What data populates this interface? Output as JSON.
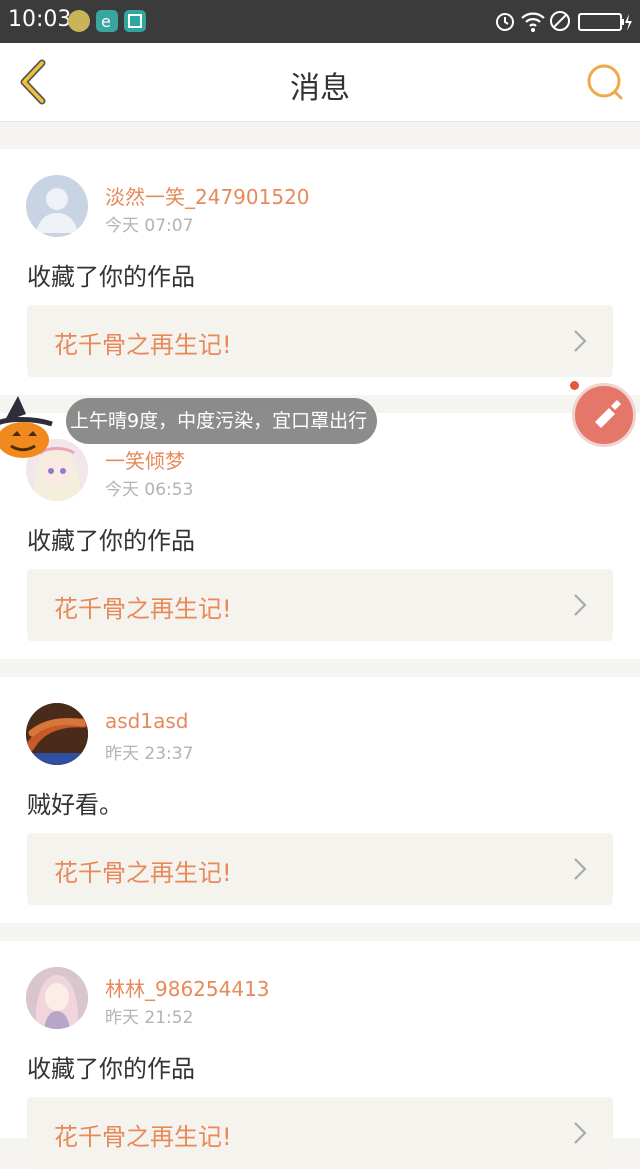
{
  "status_bar": {
    "time": "10:03"
  },
  "header": {
    "title": "消息"
  },
  "messages": [
    {
      "user": "淡然一笑_247901520",
      "time": "今天 07:07",
      "text": "收藏了你的作品",
      "work": "花千骨之再生记!"
    },
    {
      "user": "一笑倾梦",
      "time": "今天 06:53",
      "text": "收藏了你的作品",
      "work": "花千骨之再生记!"
    },
    {
      "user": "asd1asd",
      "time": "昨天 23:37",
      "text": "贼好看。",
      "work": "花千骨之再生记!"
    },
    {
      "user": "林林_986254413",
      "time": "昨天 21:52",
      "text": "收藏了你的作品",
      "work": "花千骨之再生记!"
    }
  ],
  "overlay": {
    "weather": "上午晴9度，中度污染，宜口罩出行"
  },
  "colors": {
    "accent": "#e8895a",
    "header_icon": "#f0a94a",
    "background": "#f5f4f0"
  }
}
